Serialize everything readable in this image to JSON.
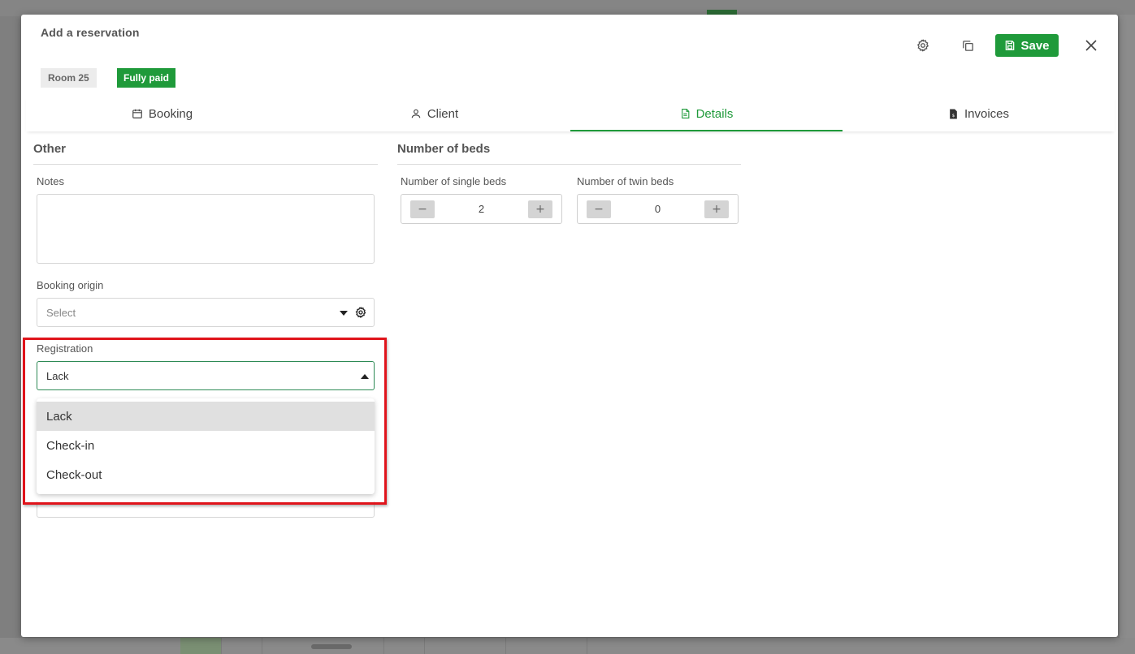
{
  "modal": {
    "title": "Add a reservation",
    "save_label": "Save",
    "room_badge": "Room 25",
    "status_badge": "Fully paid"
  },
  "tabs": [
    {
      "label": "Booking",
      "icon": "calendar-icon"
    },
    {
      "label": "Client",
      "icon": "user-icon"
    },
    {
      "label": "Details",
      "icon": "document-icon",
      "active": true
    },
    {
      "label": "Invoices",
      "icon": "invoice-icon"
    }
  ],
  "other": {
    "title": "Other",
    "notes_label": "Notes",
    "notes_value": "",
    "booking_origin_label": "Booking origin",
    "booking_origin_placeholder": "Select",
    "registration_label": "Registration",
    "registration_value": "Lack",
    "registration_options": [
      "Lack",
      "Check-in",
      "Check-out"
    ]
  },
  "beds": {
    "title": "Number of beds",
    "single_label": "Number of single beds",
    "single_value": "2",
    "twin_label": "Number of twin beds",
    "twin_value": "0"
  },
  "colors": {
    "accent": "#1f9a3a",
    "highlight_box": "#e0141b"
  }
}
